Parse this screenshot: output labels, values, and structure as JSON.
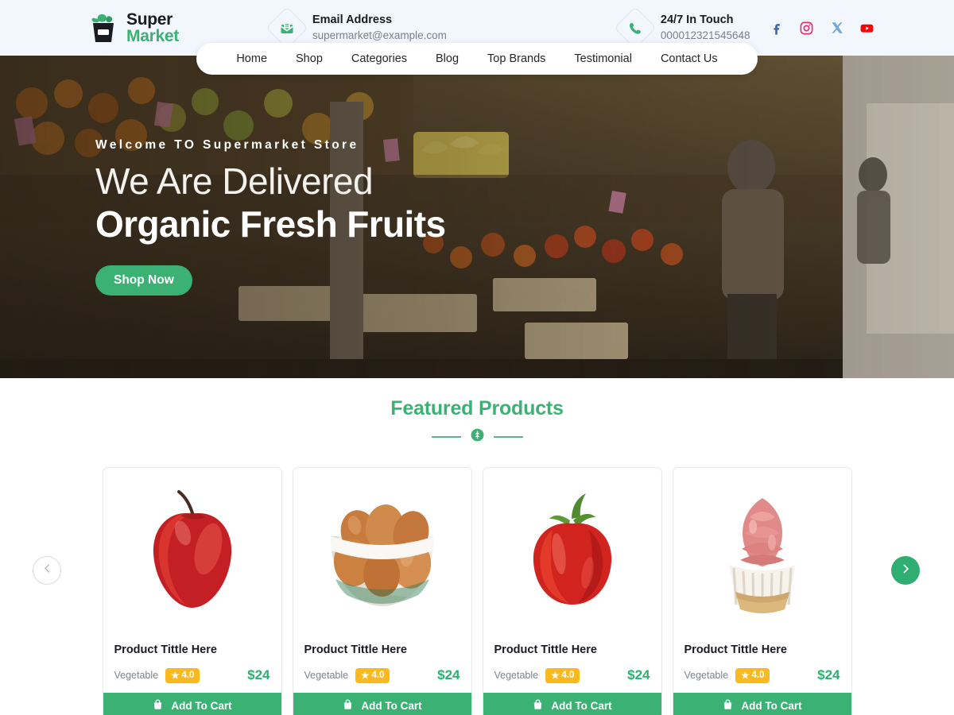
{
  "brand": {
    "name_line1": "Super",
    "name_line2": "Market",
    "logo_icon": "basket-leaf-icon"
  },
  "header": {
    "email": {
      "icon": "envelope-icon",
      "title": "Email Address",
      "value": "supermarket@example.com"
    },
    "phone": {
      "icon": "phone-icon",
      "title": "24/7 In Touch",
      "value": "000012321545648"
    },
    "socials": [
      {
        "name": "facebook",
        "glyph": "f",
        "color": "#4267B2"
      },
      {
        "name": "instagram",
        "glyph": "",
        "color": "#E1306C"
      },
      {
        "name": "x-twitter",
        "glyph": "X",
        "color": "#6FA8DC"
      },
      {
        "name": "youtube",
        "glyph": "",
        "color": "#FF0000"
      }
    ]
  },
  "nav": {
    "items": [
      {
        "label": "Home"
      },
      {
        "label": "Shop"
      },
      {
        "label": "Categories"
      },
      {
        "label": "Blog"
      },
      {
        "label": "Top Brands"
      },
      {
        "label": "Testimonial"
      },
      {
        "label": "Contact Us"
      }
    ]
  },
  "hero": {
    "eyebrow": "Welcome TO Supermarket Store",
    "title_light": "We Are Delivered",
    "title_bold": "Organic Fresh Fruits",
    "cta": "Shop Now"
  },
  "featured": {
    "title": "Featured Products",
    "divider_icon": "wheat-badge-icon",
    "prev_label": "previous",
    "next_label": "next",
    "products": [
      {
        "image": "red-apple",
        "title": "Product Tittle  Here",
        "category": "Vegetable",
        "rating": "4.0",
        "price": "$24",
        "cta": "Add To Cart"
      },
      {
        "image": "bowl-of-eggs",
        "title": "Product Tittle  Here",
        "category": "Vegetable",
        "rating": "4.0",
        "price": "$24",
        "cta": "Add To Cart"
      },
      {
        "image": "red-bell-pepper",
        "title": "Product Tittle  Here",
        "category": "Vegetable",
        "rating": "4.0",
        "price": "$24",
        "cta": "Add To Cart"
      },
      {
        "image": "pink-cupcake",
        "title": "Product Tittle  Here",
        "category": "Vegetable",
        "rating": "4.0",
        "price": "$24",
        "cta": "Add To Cart"
      }
    ]
  },
  "colors": {
    "green": "#3bb273",
    "amber": "#fbb91e",
    "header_bg": "#f2f6fd"
  }
}
